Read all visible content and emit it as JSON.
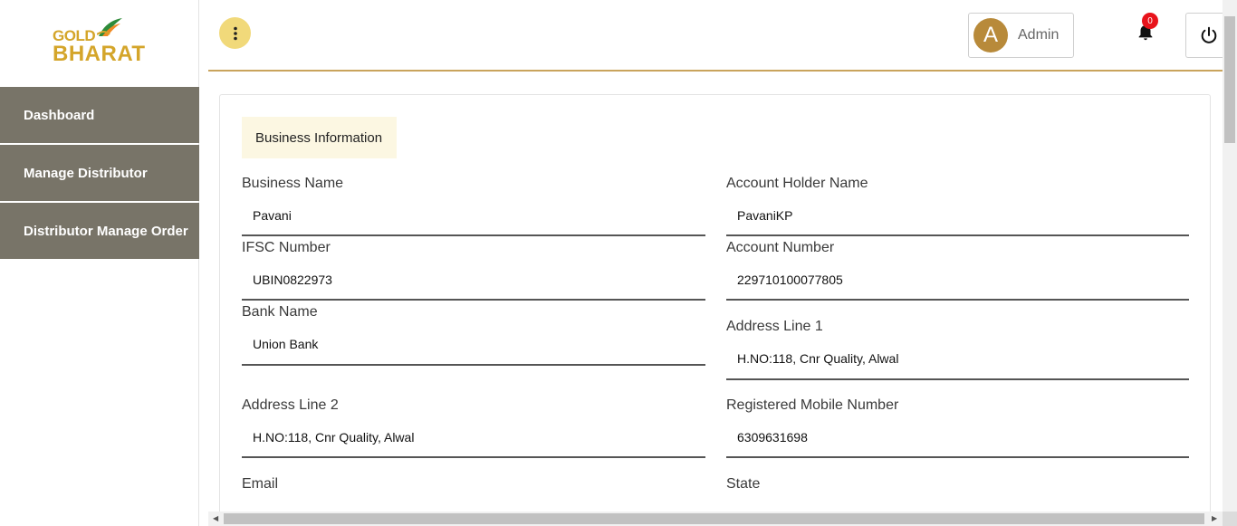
{
  "brand": {
    "line1": "GOLD",
    "line2": "BHARAT",
    "color": "#d4a52a"
  },
  "sidebar": {
    "items": [
      {
        "label": "Dashboard"
      },
      {
        "label": "Manage Distributor"
      },
      {
        "label": "Distributor Manage Order"
      }
    ]
  },
  "header": {
    "menu_icon": "kebab-menu-icon",
    "user": {
      "initial": "A",
      "name": "Admin"
    },
    "notifications": {
      "icon": "bell-icon",
      "count": "0"
    },
    "power_icon": "power-icon"
  },
  "form": {
    "section_title": "Business Information",
    "fields": [
      {
        "label": "Business Name",
        "value": "Pavani"
      },
      {
        "label": "Account Holder Name",
        "value": "PavaniKP"
      },
      {
        "label": "IFSC Number",
        "value": "UBIN0822973"
      },
      {
        "label": "Account Number",
        "value": "229710100077805"
      },
      {
        "label": "Bank Name",
        "value": "Union Bank"
      },
      {
        "label": "Address Line 1",
        "value": "H.NO:118, Cnr Quality, Alwal"
      },
      {
        "label": "Address Line 2",
        "value": "H.NO:118, Cnr Quality, Alwal"
      },
      {
        "label": "Registered Mobile Number",
        "value": "6309631698"
      },
      {
        "label": "Email",
        "value": ""
      },
      {
        "label": "State",
        "value": ""
      }
    ]
  },
  "colors": {
    "sidebar_item_bg": "#787468",
    "accent": "#c9a45c",
    "menu_button": "#f1d97a",
    "avatar": "#b88a3a",
    "badge": "#e8131b",
    "section_bg": "#fcf7e2"
  }
}
